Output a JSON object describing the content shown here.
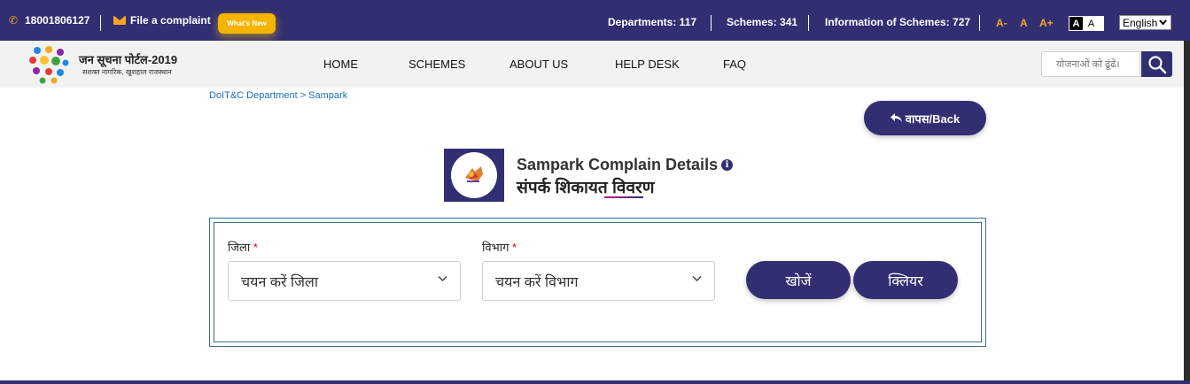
{
  "topbar": {
    "phone": "18001806127",
    "complaint": "File a complaint",
    "whats_new": "What's New",
    "departments": "Departments: 117",
    "schemes": "Schemes: 341",
    "info_schemes": "Information of Schemes: 727",
    "font_decrease": "A-",
    "font_normal": "A",
    "font_increase": "A+",
    "contrast_dark": "A",
    "contrast_light": "A",
    "language": "English"
  },
  "logo": {
    "title": "जन सूचना पोर्टल-2019",
    "subtitle": "सशक्त नागरिक, खुशहाल राजस्थान"
  },
  "nav": {
    "items": [
      "HOME",
      "SCHEMES",
      "ABOUT US",
      "HELP DESK",
      "FAQ"
    ]
  },
  "search": {
    "placeholder": "योजनाओं को ढूंढें।"
  },
  "breadcrumb": "DoIT&C Department > Sampark",
  "back_button": "वापस/Back",
  "page": {
    "title_en": "Sampark Complain Details",
    "title_hi": "संपर्क शिकायत विवरण"
  },
  "form": {
    "district_label": "जिला",
    "district_value": "चयन करें जिला",
    "department_label": "विभाग",
    "department_value": "चयन करें विभाग",
    "required_mark": "*",
    "search_button": "खोजें",
    "clear_button": "क्लियर"
  },
  "colors": {
    "brand": "#312f72",
    "accent": "#f5b400",
    "link": "#1e6fb8"
  }
}
